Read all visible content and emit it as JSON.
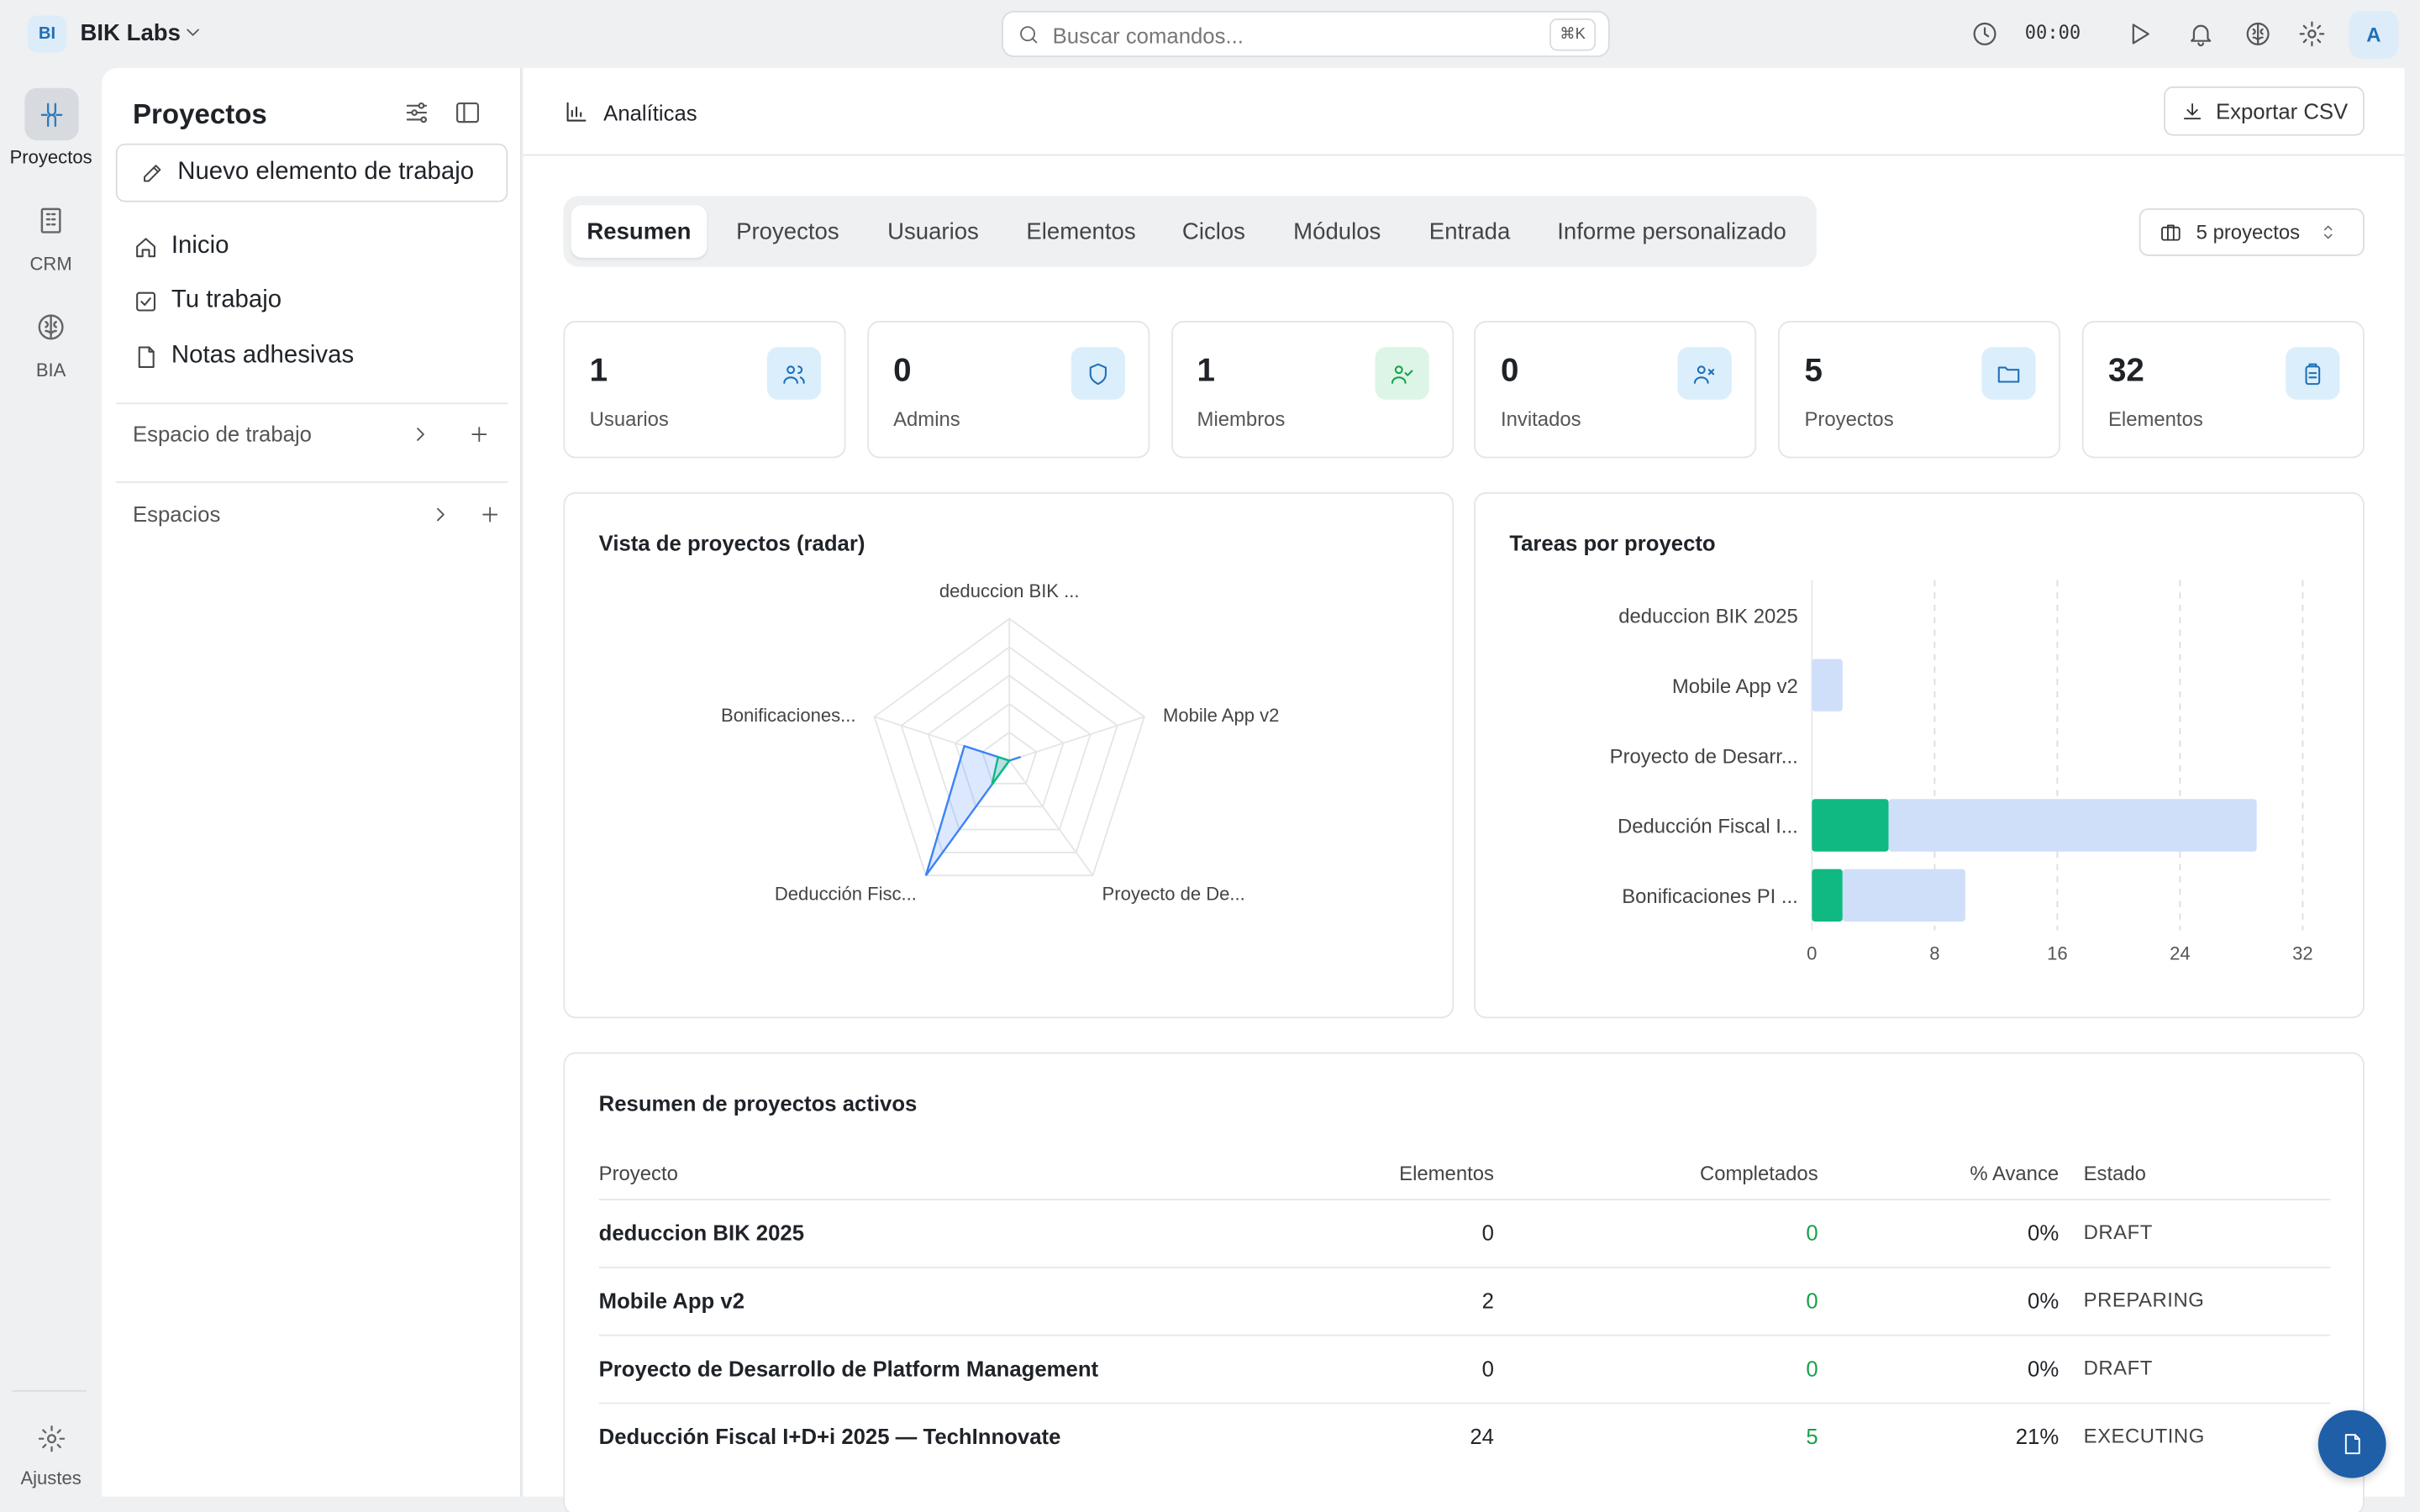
{
  "workspace": {
    "initials": "BI",
    "name": "BIK Labs"
  },
  "search": {
    "placeholder": "Buscar comandos...",
    "shortcut": "⌘K"
  },
  "timer": "00:00",
  "user": {
    "initial": "A"
  },
  "rail": [
    {
      "label": "Proyectos",
      "icon": "proyectos-icon",
      "active": true
    },
    {
      "label": "CRM",
      "icon": "building-icon"
    },
    {
      "label": "BIA",
      "icon": "brain-icon"
    },
    {
      "label": "Ajustes",
      "icon": "gear-icon"
    }
  ],
  "sidebar": {
    "title": "Proyectos",
    "new_item": "Nuevo elemento de trabajo",
    "nav": [
      {
        "label": "Inicio",
        "icon": "home-icon"
      },
      {
        "label": "Tu trabajo",
        "icon": "check-square-icon"
      },
      {
        "label": "Notas adhesivas",
        "icon": "note-icon"
      }
    ],
    "workspace_section": "Espacio de trabajo",
    "spaces_section": "Espacios"
  },
  "main": {
    "title": "Analíticas",
    "export_label": "Exportar CSV",
    "tabs": [
      "Resumen",
      "Proyectos",
      "Usuarios",
      "Elementos",
      "Ciclos",
      "Módulos",
      "Entrada",
      "Informe personalizado"
    ],
    "active_tab": 0,
    "project_selector": "5 proyectos"
  },
  "stats": [
    {
      "value": "1",
      "label": "Usuarios",
      "icon": "users-icon",
      "bg": "#dbeefb",
      "fg": "#1f6fb8"
    },
    {
      "value": "0",
      "label": "Admins",
      "icon": "shield-icon",
      "bg": "#dbeefb",
      "fg": "#1f6fb8"
    },
    {
      "value": "1",
      "label": "Miembros",
      "icon": "user-check-icon",
      "bg": "#dcf5e6",
      "fg": "#16a34a"
    },
    {
      "value": "0",
      "label": "Invitados",
      "icon": "user-x-icon",
      "bg": "#dbeefb",
      "fg": "#1f6fb8"
    },
    {
      "value": "5",
      "label": "Proyectos",
      "icon": "folder-icon",
      "bg": "#dbeefb",
      "fg": "#1f6fb8"
    },
    {
      "value": "32",
      "label": "Elementos",
      "icon": "clipboard-icon",
      "bg": "#dbeefb",
      "fg": "#1f6fb8"
    }
  ],
  "chart_data": [
    {
      "type": "radar",
      "title": "Vista de proyectos (radar)",
      "categories": [
        "deduccion BIK ...",
        "Mobile App v2",
        "Proyecto de De...",
        "Deducción Fisc...",
        "Bonificaciones..."
      ],
      "max": 24,
      "series": [
        {
          "values": [
            0,
            2,
            0,
            24,
            8
          ],
          "color": "#3b82f6"
        },
        {
          "values": [
            0,
            0,
            0,
            5,
            2
          ],
          "color": "#10b981"
        }
      ]
    },
    {
      "type": "bar",
      "orientation": "horizontal",
      "stacked": true,
      "title": "Tareas por proyecto",
      "categories": [
        "deduccion BIK 2025",
        "Mobile App v2",
        "Proyecto de Desarr...",
        "Deducción Fiscal I...",
        "Bonificaciones PI ..."
      ],
      "series": [
        {
          "values": [
            0,
            0,
            0,
            5,
            2
          ],
          "color": "#10b981"
        },
        {
          "values": [
            0,
            2,
            0,
            24,
            8
          ],
          "color": "#cfdffa"
        }
      ],
      "xlim": [
        0,
        32
      ],
      "xticks": [
        0,
        8,
        16,
        24,
        32
      ],
      "grid": true
    }
  ],
  "summary": {
    "title": "Resumen de proyectos activos",
    "columns": [
      "Proyecto",
      "Elementos",
      "Completados",
      "% Avance",
      "Estado"
    ],
    "rows": [
      {
        "name": "deduccion BIK 2025",
        "items": "0",
        "done": "0",
        "progress": "0%",
        "state": "DRAFT"
      },
      {
        "name": "Mobile App v2",
        "items": "2",
        "done": "0",
        "progress": "0%",
        "state": "PREPARING"
      },
      {
        "name": "Proyecto de Desarrollo de Platform Management",
        "items": "0",
        "done": "0",
        "progress": "0%",
        "state": "DRAFT"
      },
      {
        "name": "Deducción Fiscal I+D+i 2025 — TechInnovate",
        "items": "24",
        "done": "5",
        "progress": "21%",
        "state": "EXECUTING"
      }
    ]
  }
}
